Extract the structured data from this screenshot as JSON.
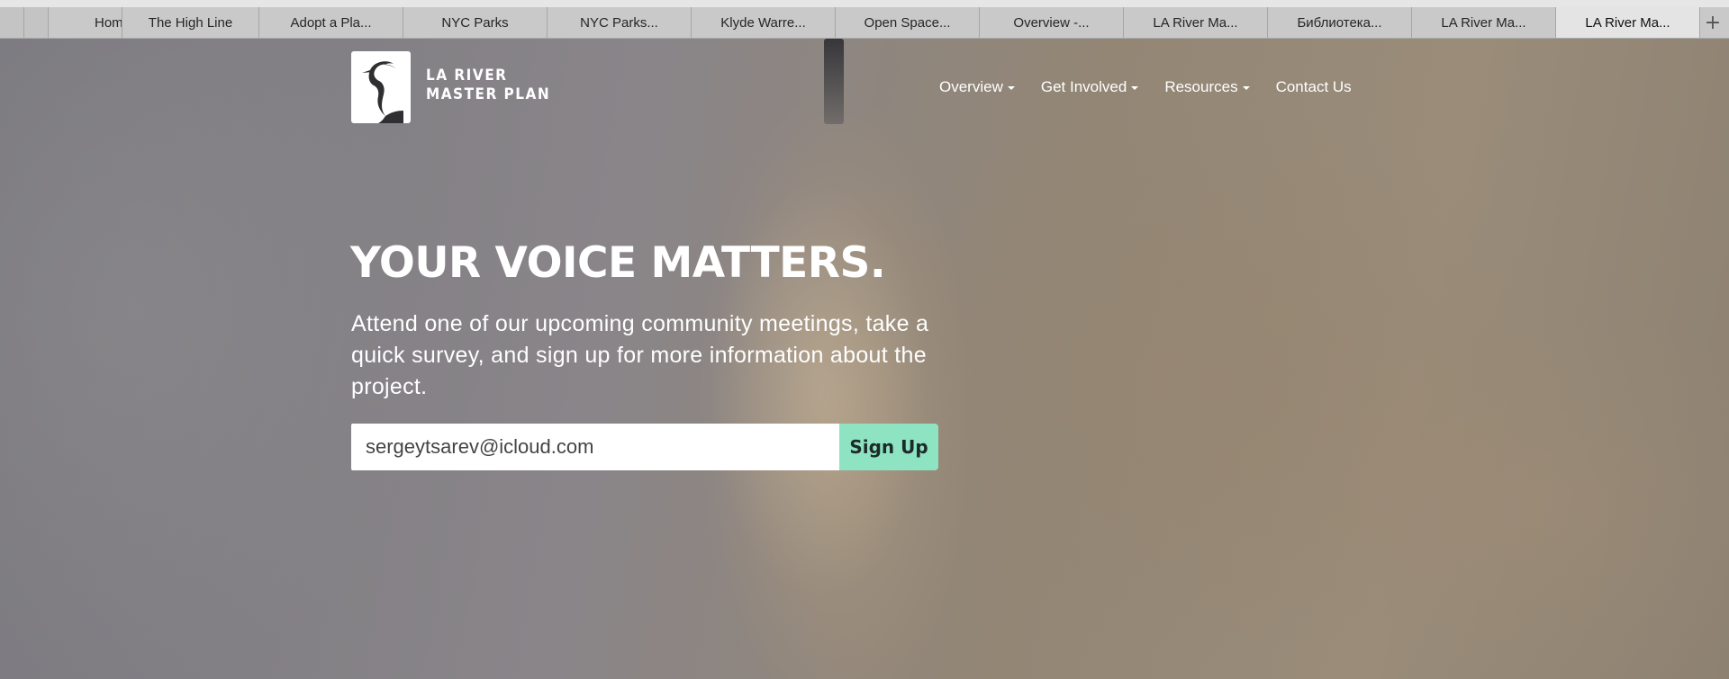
{
  "browser": {
    "tabs": [
      {
        "label": "Hom",
        "active": false
      },
      {
        "label": "The High Line",
        "active": false
      },
      {
        "label": "Adopt a Pla...",
        "active": false
      },
      {
        "label": "NYC Parks",
        "active": false
      },
      {
        "label": "NYC Parks...",
        "active": false
      },
      {
        "label": "Klyde Warre...",
        "active": false
      },
      {
        "label": "Open Space...",
        "active": false
      },
      {
        "label": "Overview -...",
        "active": false
      },
      {
        "label": "LA River Ma...",
        "active": false
      },
      {
        "label": "Библиотека...",
        "active": false
      },
      {
        "label": "LA River Ma...",
        "active": false
      },
      {
        "label": "LA River Ma...",
        "active": true
      }
    ],
    "new_tab_label": "+"
  },
  "site": {
    "logo_line1": "LA RIVER",
    "logo_line2": "MASTER PLAN"
  },
  "nav": {
    "items": [
      {
        "label": "Overview",
        "dropdown": true
      },
      {
        "label": "Get Involved",
        "dropdown": true
      },
      {
        "label": "Resources",
        "dropdown": true
      },
      {
        "label": "Contact Us",
        "dropdown": false
      }
    ]
  },
  "hero": {
    "headline": "YOUR VOICE MATTERS.",
    "subtext": "Attend one of our upcoming community meetings, take a quick survey, and sign up for more information about the project."
  },
  "signup": {
    "email_value": "sergeytsarev@icloud.com",
    "button_label": "Sign Up"
  },
  "colors": {
    "signup_button": "#8de3c2",
    "text": "#ffffff"
  }
}
